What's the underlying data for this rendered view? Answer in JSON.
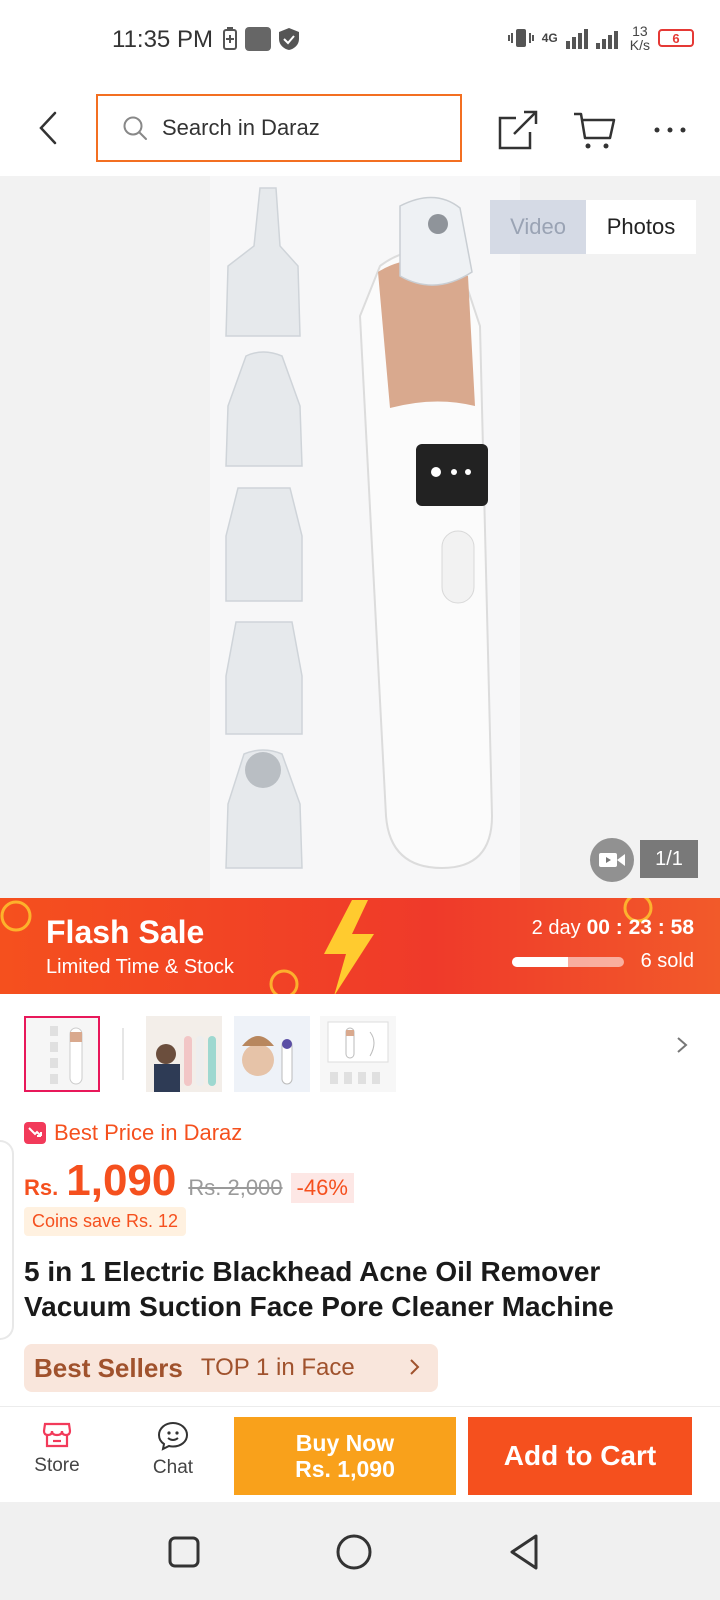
{
  "status_bar": {
    "time": "11:35 PM",
    "network": "4G",
    "speed_value": "13",
    "speed_unit": "K/s",
    "battery": "6"
  },
  "top_nav": {
    "search_placeholder": "Search in Daraz"
  },
  "media": {
    "toggle_video": "Video",
    "toggle_photos": "Photos",
    "counter": "1/1"
  },
  "flash_sale": {
    "title": "Flash Sale",
    "subtitle": "Limited Time & Stock",
    "days": "2 day",
    "countdown": "00 : 23 : 58",
    "sold": "6 sold",
    "sold_progress": 0.5
  },
  "price": {
    "best_price_label": "Best Price in Daraz",
    "currency": "Rs.",
    "current": "1,090",
    "original": "Rs. 2,000",
    "discount": "-46%",
    "coins": "Coins save Rs. 12"
  },
  "product": {
    "title": "5 in 1 Electric Blackhead Acne Oil Remover Vacuum Suction Face Pore Cleaner Machine"
  },
  "bestsellers": {
    "badge": "Best Sellers",
    "rank": "TOP 1 in Face"
  },
  "action_bar": {
    "store_label": "Store",
    "chat_label": "Chat",
    "buy_now_line1": "Buy Now",
    "buy_now_line2": "Rs. 1,090",
    "add_to_cart": "Add to Cart"
  },
  "colors": {
    "brand_orange": "#f5501e",
    "buy_now": "#f9a11b",
    "search_border": "#f36f21"
  }
}
